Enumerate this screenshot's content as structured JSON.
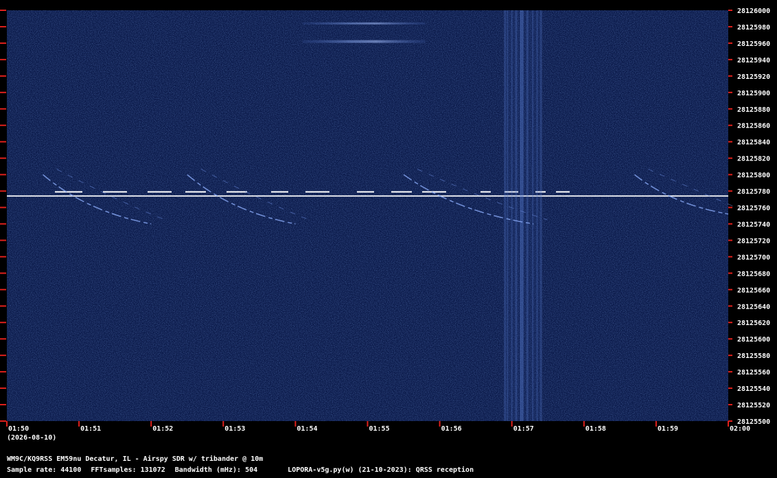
{
  "station": {
    "title": "WM9C/KQ9RSS EM59nu Decatur, IL - Airspy SDR w/ tribander @ 10m",
    "sample_rate": "Sample rate: 44100",
    "fft_samples": "FFTsamples: 131072",
    "bandwidth": "Bandwidth (mHz): 504",
    "software": "LOPORA-v5g.py(w) (21-10-2023): QRSS reception"
  },
  "colors": {
    "background": "#0b1a4a",
    "trace": "#ffffff",
    "tick": "#e0201c"
  },
  "chart_data": {
    "type": "heatmap",
    "title": "",
    "date_label": "(2026-08-10)",
    "x_ticks": [
      "01:50",
      "01:51",
      "01:52",
      "01:53",
      "01:54",
      "01:55",
      "01:56",
      "01:57",
      "01:58",
      "01:59",
      "02:00"
    ],
    "y_ticks": [
      "28126000",
      "28125980",
      "28125960",
      "28125940",
      "28125920",
      "28125900",
      "28125880",
      "28125860",
      "28125840",
      "28125820",
      "28125800",
      "28125780",
      "28125760",
      "28125740",
      "28125720",
      "28125700",
      "28125680",
      "28125660",
      "28125640",
      "28125620",
      "28125600",
      "28125580",
      "28125560",
      "28125540",
      "28125520",
      "28125500"
    ],
    "x_range": [
      "01:50",
      "02:00"
    ],
    "y_range_hz": [
      28125500,
      28126000
    ],
    "signals": [
      {
        "kind": "steady-carrier-with-keying",
        "freq_hz": 28125774,
        "start": "01:50",
        "end": "02:00"
      },
      {
        "kind": "interference-band",
        "freq_hz_low": 28125962,
        "freq_hz_high": 28125984,
        "start": "01:54.1",
        "end": "01:55.8"
      },
      {
        "kind": "broadband-noise-column",
        "start": "01:56.9",
        "end": "01:57.4"
      },
      {
        "kind": "drifting-trace",
        "freq_hz_start": 28125800,
        "freq_hz_end": 28125740,
        "start": "01:50.5",
        "end": "01:52.0"
      },
      {
        "kind": "drifting-trace",
        "freq_hz_start": 28125800,
        "freq_hz_end": 28125740,
        "start": "01:52.5",
        "end": "01:54.0"
      },
      {
        "kind": "drifting-trace",
        "freq_hz_start": 28125800,
        "freq_hz_end": 28125740,
        "start": "01:55.5",
        "end": "01:57.3"
      },
      {
        "kind": "drifting-trace",
        "freq_hz_start": 28125800,
        "freq_hz_end": 28125752,
        "start": "01:58.7",
        "end": "02:00"
      }
    ]
  }
}
